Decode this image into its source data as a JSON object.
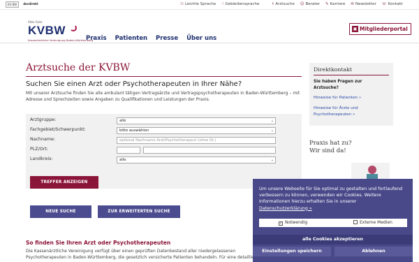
{
  "topbar": {
    "logo1": "KV BW",
    "logo2": "docdirekt",
    "links": [
      {
        "icon": "easy-language-icon",
        "glyph": "⚇",
        "label": "Leichte Sprache"
      },
      {
        "icon": "sign-language-icon",
        "glyph": "☝",
        "label": "Gebärdensprache"
      },
      {
        "icon": "doctor-search-icon",
        "glyph": "⚕",
        "label": "Arztsuche"
      },
      {
        "icon": "consultant-icon",
        "glyph": "☺",
        "label": "Berater"
      },
      {
        "icon": "career-icon",
        "glyph": "✎",
        "label": "Karriere"
      },
      {
        "icon": "newsletter-icon",
        "glyph": "✉",
        "label": "Newsletter"
      },
      {
        "icon": "contact-icon",
        "glyph": "☏",
        "label": "Kontakt"
      }
    ]
  },
  "header": {
    "brand_small": "Alles Gute",
    "brand": "KVBW",
    "brand_sub": "Kassenärztliche Vereinigung Baden-Württemberg",
    "nav": [
      "Praxis",
      "Patienten",
      "Presse",
      "Über uns"
    ],
    "member_button": "Mitgliederportal"
  },
  "main": {
    "title": "Arztsuche der KVBW",
    "subtitle": "Suchen Sie einen Arzt oder Psychotherapeuten in Ihrer Nähe?",
    "intro": "Mit unserer Arztsuche finden Sie alle ambulant tätigen Vertragsärzte und Vertragspsychotherapeuten in Baden-Württemberg – mit Adresse und Sprechzeiten sowie Angaben zu Qualifikationen und Leistungen der Praxis.",
    "form": {
      "arztgruppe_label": "Arztgruppe:",
      "arztgruppe_value": "alle",
      "fachgebiet_label": "Fachgebiet/Schwerpunkt:",
      "fachgebiet_value": "bitte auswählen",
      "nachname_label": "Nachname:",
      "nachname_placeholder": "optional Nachname Arzt/Psychotherapeut (ohne Dr.)",
      "plz_label": "PLZ/Ort:",
      "landkreis_label": "Landkreis:",
      "landkreis_value": "alle",
      "submit": "TREFFER ANZEIGEN"
    },
    "new_search": "NEUE SUCHE",
    "extended_search": "ZUR ERWEITERTEN SUCHE",
    "section_title": "So finden Sie Ihren Arzt oder Psychotherapeuten",
    "section_text_1": "Die Kassenärztliche Vereinigung verfügt über einen geprüften Datenbestand aller niedergelassenen",
    "section_text_2": "Psychotherapeuten in Baden-Württemberg, die gesetzlich versicherte Patienten behandeln. Für eine detaillierte"
  },
  "sidebar": {
    "title": "Direktkontakt",
    "question_1": "Sie haben Fragen zur",
    "question_2": "Arztsuche?",
    "link1": "Hinweise für Patienten »",
    "link2_1": "Hinweise für Ärzte und",
    "link2_2": "Psychotherapeuten »",
    "promo_1": "Praxis hat zu?",
    "promo_2": "Wir sind da!"
  },
  "cookie": {
    "text": "Um unsere Webseite für Sie optimal zu gestalten und fortlaufend verbessern zu können, verwenden wir Cookies. Weitere Informationen hierzu erhalten Sie in unserer",
    "link": "Datenschutzerklärung »",
    "option1": "Notwendig",
    "option2": "Externe Medien",
    "accept": "alle Cookies akzeptieren",
    "settings": "Einstellungen speichern",
    "deny": "Ablehnen"
  },
  "colors": {
    "accent": "#8b1538",
    "brand_blue": "#1d2f6f",
    "cookie_bg": "#49498a"
  }
}
